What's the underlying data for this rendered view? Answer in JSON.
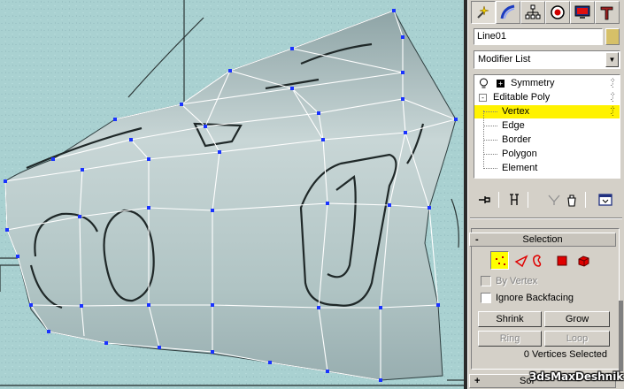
{
  "app": {
    "name": "3ds Max",
    "watermark": "3dsMaxDeshnik"
  },
  "command_panel": {
    "tabs": [
      {
        "name": "create",
        "icon": "create-icon",
        "active": true
      },
      {
        "name": "modify",
        "icon": "modify-icon",
        "active": false
      },
      {
        "name": "hierarchy",
        "icon": "hierarchy-icon",
        "active": false
      },
      {
        "name": "motion",
        "icon": "motion-icon",
        "active": false
      },
      {
        "name": "display",
        "icon": "display-icon",
        "active": false
      },
      {
        "name": "utilities",
        "icon": "utilities-icon",
        "active": false
      }
    ],
    "object_name": "Line01",
    "object_color": "#d6c068",
    "modifier_list": {
      "selected": "Modifier List"
    },
    "stack": {
      "items": [
        {
          "label": "Symmetry",
          "expander": "+"
        },
        {
          "label": "Editable Poly",
          "expander": "-"
        },
        {
          "label": "Vertex",
          "selected": true
        },
        {
          "label": "Edge"
        },
        {
          "label": "Border"
        },
        {
          "label": "Polygon"
        },
        {
          "label": "Element"
        }
      ]
    }
  },
  "selection_rollout": {
    "sign": "-",
    "title": "Selection",
    "modes": [
      "vertex-mode-icon",
      "edge-mode-icon",
      "border-mode-icon",
      "polygon-mode-icon",
      "element-mode-icon"
    ],
    "by_vertex": "By Vertex",
    "ignore_backfacing": "Ignore Backfacing",
    "shrink": "Shrink",
    "grow": "Grow",
    "ring": "Ring",
    "loop": "Loop",
    "status": "0 Vertices Selected"
  },
  "next_rollout": {
    "sign": "+",
    "title": "Sof"
  },
  "colors": {
    "viewport_bg": "#a9d1d1",
    "mesh_fill": "#b5c9c8",
    "mesh_edges": "#ffffff",
    "vertex": "#1a33ff",
    "selected_item": "#fff200"
  }
}
